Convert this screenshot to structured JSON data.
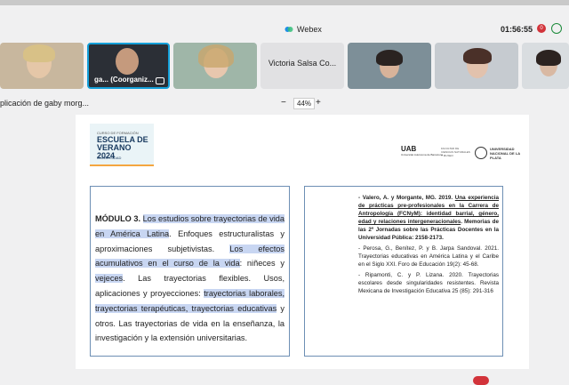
{
  "window": {
    "title": "Webex",
    "meeting_timer": "01:56:55",
    "recording_count": "0"
  },
  "participants": [
    {
      "name": ""
    },
    {
      "name": "ga...",
      "role_label": "(Coorganiz..."
    },
    {
      "name": ""
    },
    {
      "name": "Victoria Salsa Co..."
    },
    {
      "name": ""
    },
    {
      "name": ""
    },
    {
      "name": ""
    }
  ],
  "share": {
    "title": "plicación de gaby morg...",
    "zoom_minus": "−",
    "zoom_level": "44%",
    "zoom_plus": "+"
  },
  "document": {
    "logo": {
      "line1": "CURSO DE FORMACIÓN",
      "line2": "ESCUELA DE VERANO 2024",
      "line3": "UNIVERSIDAD"
    },
    "uab": "UAB",
    "uab_sub": "Universitat Autònoma de Barcelona",
    "facultad": "FACULTAD DE CIENCIAS NATURALES Y MUSEO",
    "unlp": "UNIVERSIDAD NACIONAL DE LA PLATA",
    "left_box": {
      "module_label": "MÓDULO 3.",
      "hl1": "Los estudios sobre trayectorias de vida en América Latina",
      "t1": ". Enfoques estructuralistas y aproximaciones subjetivistas. ",
      "hl2": "Los efectos acumulativos en el curso de la vida",
      "t2": ": niñeces y ",
      "hl3": "vejeces",
      "t3": ". Las trayectorias flexibles. Usos, aplicaciones y proyecciones: ",
      "hl4": "trayectorias laborales, trayectorias terapéuticas, trayectorias educativas",
      "t4": " y otros. Las trayectorias de vida en la enseñanza, la investigación y la extensión universitarias."
    },
    "right_box": {
      "ref1_prefix": "- Valero, A. y Morgante, MG. 2019. ",
      "ref1_title": "Una experiencia de prácticas pre-profesionales en la Carrera de Antropología (FCNyM): identidad barrial, género, edad y relaciones intergeneracionales",
      "ref1_suffix": ". Memorias de las 2º Jornadas sobre las Prácticas Docentes en la Universidad Pública: 2158-2173.",
      "ref2": "- Perosa, G., Benítez, P. y B. Jarpa Sandoval. 2021. Trayectorias educativas en América Latina y el Caribe en el Siglo XXI. Foro de Educación 19(2): 45-68.",
      "ref3": "- Ripamonti, C. y P. Lizana.  2020. Trayectorias escolares desde singularidades resistentes. Revista Mexicana de Investigación Educativa 25 (85): 291-316"
    }
  },
  "colors": {
    "active_border": "#14a0d9",
    "highlight": "#c8d6f2",
    "record_red": "#d2333a"
  }
}
